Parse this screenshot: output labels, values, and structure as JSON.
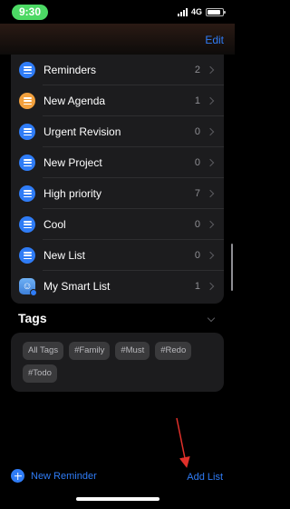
{
  "status_bar": {
    "time": "9:30",
    "network": "4G",
    "battery_level": 0.85
  },
  "header": {
    "edit_label": "Edit"
  },
  "lists": [
    {
      "name": "Reminders",
      "count": "2",
      "color": "#2f7cf6"
    },
    {
      "name": "New Agenda",
      "count": "1",
      "color": "#f2a03d"
    },
    {
      "name": "Urgent Revision",
      "count": "0",
      "color": "#2f7cf6"
    },
    {
      "name": "New Project",
      "count": "0",
      "color": "#2f7cf6"
    },
    {
      "name": "High priority",
      "count": "7",
      "color": "#2f7cf6"
    },
    {
      "name": "Cool",
      "count": "0",
      "color": "#2f7cf6"
    },
    {
      "name": "New List",
      "count": "0",
      "color": "#2f7cf6"
    },
    {
      "name": "My Smart List",
      "count": "1",
      "icon": "smart-list-icon"
    }
  ],
  "tags": {
    "title": "Tags",
    "items": [
      "All Tags",
      "#Family",
      "#Must",
      "#Redo",
      "#Todo"
    ]
  },
  "toolbar": {
    "new_reminder_label": "New Reminder",
    "add_list_label": "Add List"
  },
  "colors": {
    "accent": "#2f7cf6",
    "annotation_arrow": "#e0302a"
  }
}
